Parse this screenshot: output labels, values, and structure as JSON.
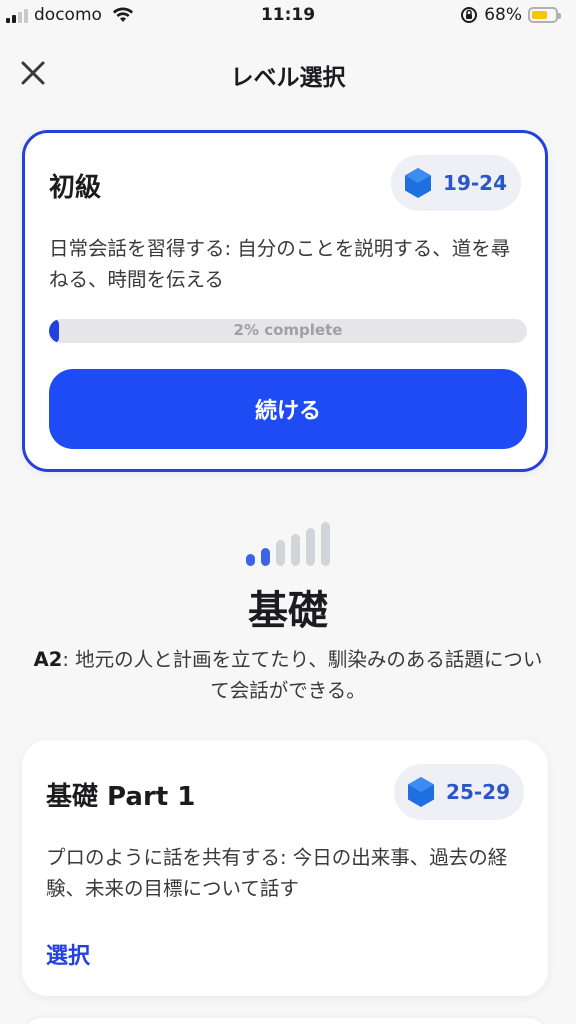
{
  "status_bar": {
    "carrier": "docomo",
    "time": "11:19",
    "battery_percent": "68%",
    "battery_level": 0.68
  },
  "nav": {
    "title": "レベル選択"
  },
  "current_level_card": {
    "title": "初級",
    "xp_range": "19-24",
    "description": "日常会話を習得する: 自分のことを説明する、道を尋ねる、時間を伝える",
    "progress_label": "2% complete",
    "progress_value": 0.02,
    "button_label": "続ける"
  },
  "level_section": {
    "bars_total": 6,
    "bars_active": 2,
    "title": "基礎",
    "cefr": "A2",
    "description": ": 地元の人と計画を立てたり、馴染みのある話題について会話ができる。"
  },
  "part_card": {
    "title": "基礎 Part 1",
    "xp_range": "25-29",
    "description": "プロのように話を共有する: 今日の出来事、過去の経験、未来の目標について話す",
    "link_label": "選択"
  },
  "colors": {
    "accent": "#1f4bf5",
    "badge_text": "#2956c8",
    "hex_icon": "#1e6fe0"
  },
  "icons": [
    "signal-icon",
    "wifi-icon",
    "rotation-lock-icon",
    "battery-icon",
    "close-icon",
    "hexagon-gem-icon"
  ]
}
